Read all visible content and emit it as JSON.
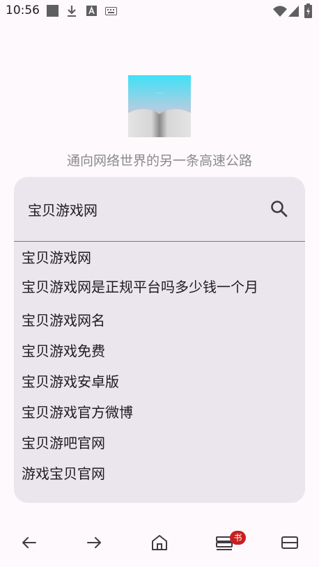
{
  "status_bar": {
    "time": "10:56",
    "icons": [
      "square-icon",
      "download-icon",
      "font-a-icon",
      "keyboard-icon",
      "wifi-icon",
      "signal-icon",
      "battery-charging-icon"
    ]
  },
  "brand": {
    "tagline": "通向网络世界的另一条高速公路",
    "logo": "open-book-logo"
  },
  "search": {
    "value": "宝贝游戏网",
    "icon": "search-icon"
  },
  "suggestions": [
    "宝贝游戏网",
    "宝贝游戏网是正规平台吗多少钱一个月",
    "宝贝游戏网名",
    "宝贝游戏免费",
    "宝贝游戏安卓版",
    "宝贝游戏官方微博",
    "宝贝游吧官网",
    "游戏宝贝官网"
  ],
  "bottom_nav": {
    "items": [
      "back-icon",
      "forward-icon",
      "home-icon",
      "bookmarks-icon",
      "tabs-icon"
    ],
    "badge": "书"
  },
  "colors": {
    "background": "#fdf9fd",
    "card": "#ebe6ee",
    "badge": "#c8201f",
    "tagline": "#8a8a8e"
  }
}
